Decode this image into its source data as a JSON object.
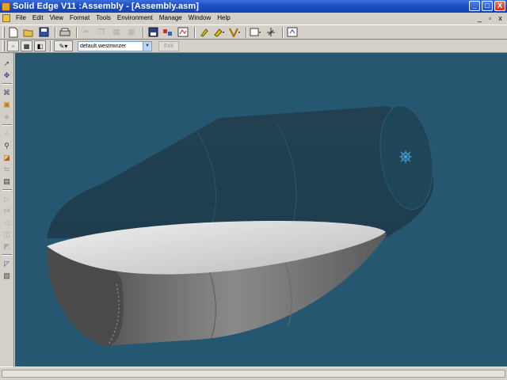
{
  "window": {
    "title": "Solid Edge V11 :Assembly - [Assembly.asm]",
    "controls": [
      "_",
      "□",
      "X"
    ]
  },
  "menu": {
    "items": [
      "File",
      "Edit",
      "View",
      "Format",
      "Tools",
      "Environment",
      "Manage",
      "Window",
      "Help"
    ],
    "mdi_controls": [
      "_",
      "▫",
      "x"
    ]
  },
  "toolbar_main": {
    "icons": [
      "new-icon",
      "open-icon",
      "save-icon",
      "print-icon",
      "cut-icon",
      "copy-icon",
      "paste-icon",
      "paste-special-icon",
      "save-as-icon",
      "insert-part-icon",
      "parts-library-icon",
      "highlight-icon",
      "color-icon",
      "view-orient-icon",
      "zoom-icon",
      "axis-icon",
      "refresh-icon"
    ]
  },
  "toolbar_style": {
    "style_value": "default.westminzer",
    "edit_label": "Edit"
  },
  "left_tools": {
    "icons": [
      "select-icon",
      "move-icon",
      "relations-icon",
      "assemble-icon",
      "part-icon",
      "feature-icon",
      "mate-icon",
      "align-icon",
      "flash-fit-icon",
      "pattern-icon",
      "mirror-icon",
      "replace-icon",
      "explode-icon",
      "simplify-icon",
      "property-icon"
    ]
  },
  "viewport": {
    "background": "#265770",
    "body_dark": "#1f4658",
    "body_light": "#c8c8c8",
    "body_gray": "#5b5b5b"
  }
}
